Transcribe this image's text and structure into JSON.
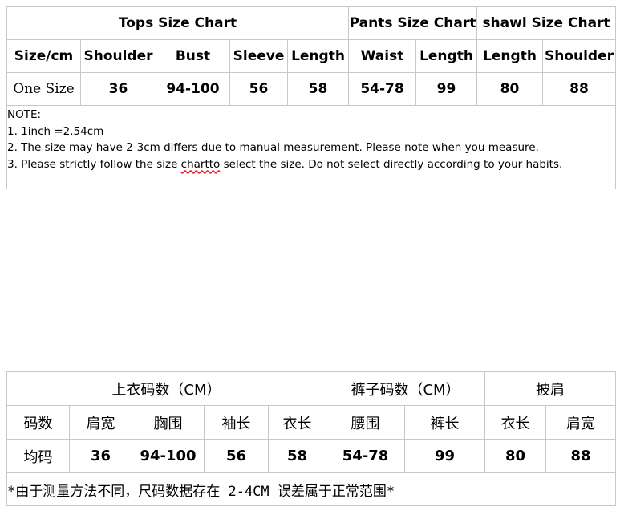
{
  "english": {
    "group_headers": [
      "Tops Size Chart",
      "Pants Size Chart",
      "shawl Size Chart"
    ],
    "columns": [
      "Size/cm",
      "Shoulder",
      "Bust",
      "Sleeve",
      "Length",
      "Waist",
      "Length",
      "Length",
      "Shoulder"
    ],
    "row": [
      "One Size",
      "36",
      "94-100",
      "56",
      "58",
      "54-78",
      "99",
      "80",
      "88"
    ],
    "notes": {
      "title": "NOTE:",
      "line1": "1. 1inch =2.54cm",
      "line2": "2. The size may have 2-3cm differs due to manual measurement. Please note when you measure.",
      "line3_a": "3. Please strictly follow the size ",
      "line3_b": "chartto",
      "line3_c": " select the size. Do not select directly according to your habits."
    }
  },
  "chinese": {
    "group_headers": [
      "上衣码数（CM）",
      "裤子码数（CM）",
      "披肩"
    ],
    "columns": [
      "码数",
      "肩宽",
      "胸围",
      "袖长",
      "衣长",
      "腰围",
      "裤长",
      "衣长",
      "肩宽"
    ],
    "row": [
      "均码",
      "36",
      "94-100",
      "56",
      "58",
      "54-78",
      "99",
      "80",
      "88"
    ],
    "note": "*由于测量方法不同，尺码数据存在 2-4CM 误差属于正常范围*"
  }
}
